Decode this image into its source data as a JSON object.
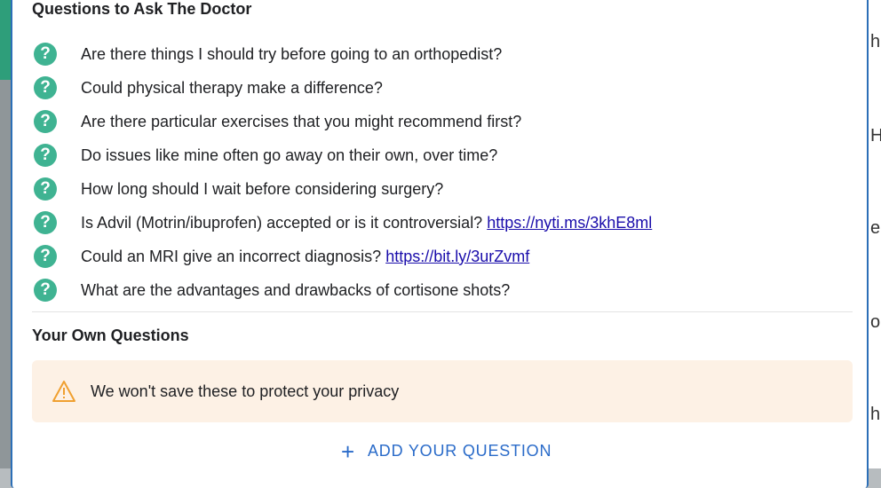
{
  "background": {
    "right_chars": [
      "h",
      "H",
      "e",
      "o",
      "h"
    ]
  },
  "dialog": {
    "questions_title": "Questions to Ask The Doctor",
    "questions": [
      {
        "text": "Are there things I should try before going to an orthopedist?",
        "link": ""
      },
      {
        "text": "Could physical therapy make a difference?",
        "link": ""
      },
      {
        "text": "Are there particular exercises that you might recommend first?",
        "link": ""
      },
      {
        "text": "Do issues like mine often go away on their own, over time?",
        "link": ""
      },
      {
        "text": "How long should I wait before considering surgery?",
        "link": ""
      },
      {
        "text": "Is Advil (Motrin/ibuprofen) accepted or is it controversial?",
        "link": "https://nyti.ms/3khE8ml"
      },
      {
        "text": "Could an MRI give an incorrect diagnosis?",
        "link": "https://bit.ly/3urZvmf"
      },
      {
        "text": "What are the advantages and drawbacks of cortisone shots?",
        "link": ""
      }
    ],
    "own_questions_title": "Your Own Questions",
    "privacy_notice": "We won't save these to protect your privacy",
    "add_question_label": "ADD YOUR QUESTION",
    "colors": {
      "question_icon": "#3fb392",
      "link": "#1a0dab",
      "notice_bg": "#fdf1e5",
      "warning_icon": "#f0a030",
      "button": "#2a6bc9"
    }
  }
}
